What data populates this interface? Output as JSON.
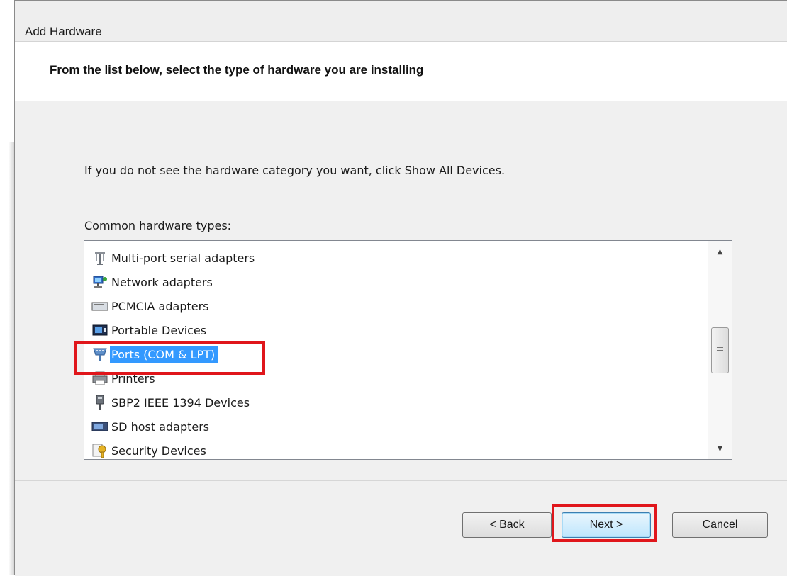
{
  "window": {
    "title": "Add Hardware"
  },
  "header": {
    "title": "From the list below, select the type of hardware you are installing"
  },
  "body": {
    "instruction": "If you do not see the hardware category you want, click Show All Devices.",
    "list_label": "Common hardware types:"
  },
  "hardware_list": {
    "items": [
      {
        "label": "Multi-port serial adapters",
        "icon": "serial-adapter-icon"
      },
      {
        "label": "Network adapters",
        "icon": "network-adapter-icon"
      },
      {
        "label": "PCMCIA adapters",
        "icon": "pcmcia-icon"
      },
      {
        "label": "Portable Devices",
        "icon": "portable-device-icon"
      },
      {
        "label": "Ports (COM & LPT)",
        "icon": "port-icon",
        "selected": true
      },
      {
        "label": "Printers",
        "icon": "printer-icon"
      },
      {
        "label": "SBP2 IEEE 1394 Devices",
        "icon": "ieee1394-icon"
      },
      {
        "label": "SD host adapters",
        "icon": "sd-adapter-icon"
      },
      {
        "label": "Security Devices",
        "icon": "security-device-icon"
      }
    ],
    "selected_index": 4
  },
  "buttons": {
    "back": "< Back",
    "next": "Next >",
    "cancel": "Cancel"
  },
  "colors": {
    "selection": "#3399ff",
    "highlight": "#e0161b"
  }
}
